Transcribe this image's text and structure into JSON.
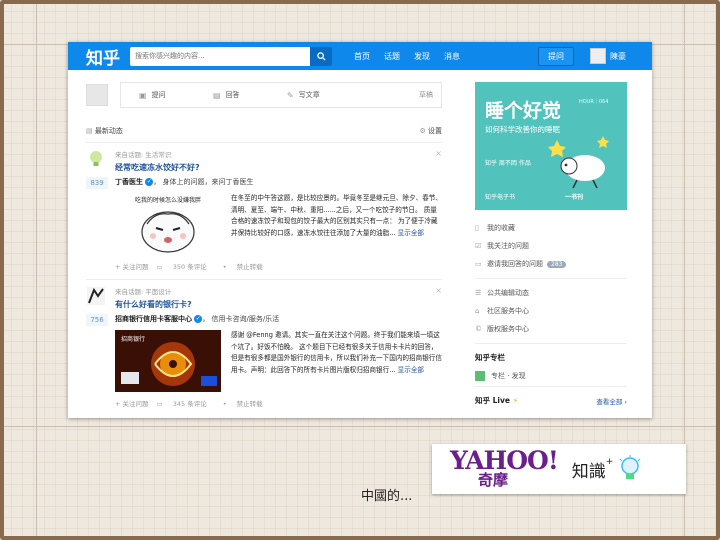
{
  "app": {
    "logo": "知乎"
  },
  "topbar": {
    "search_placeholder": "搜索你感兴趣的内容...",
    "nav": [
      "首页",
      "话题",
      "发现",
      "消息"
    ],
    "ask_label": "提问",
    "username": "陳豪"
  },
  "compose": {
    "items": [
      {
        "icon": "question-icon",
        "label": "提问"
      },
      {
        "icon": "answer-icon",
        "label": "回答"
      },
      {
        "icon": "write-icon",
        "label": "写文章"
      }
    ],
    "draft": "草稿"
  },
  "feed": {
    "title": "最新动态",
    "settings": "设置",
    "items": [
      {
        "source": "来自话题: 生活常识",
        "question": "经常吃速冻水饺好不好?",
        "votes": "839",
        "author": "丁香医生",
        "author_desc": "身体上的问题，来问丁香医生",
        "image_caption": "吃我的时候怎么没嫌我胖",
        "text": "在冬至的中午答这题，是比较应景的。毕竟冬至是继元旦、除夕、春节、清明、夏至、端午、中秋、重阳......之后，又一个吃饺子的节日。 质量合格的速冻饺子和现包的饺子最大的区别其实只有一点： 为了便于冷藏并保持比较好的口感，速冻水饺往往添加了大量的油脂...",
        "show_all": "显示全部",
        "actions": [
          "+ 关注问题",
          "350 条评论",
          "禁止转载"
        ]
      },
      {
        "source": "来自话题: 平面设计",
        "question": "有什么好看的银行卡?",
        "votes": "756",
        "author": "招商银行信用卡客服中心",
        "author_desc": "信用卡咨询/服务/乐活",
        "image_caption": "招商银行",
        "text": "感谢 @Fenng 邀请。其实一直在关注这个问题。终于我们能来填一填这个坑了。好饭不怕晚。 这个题目下已经有很多关于信用卡卡片的回答，但是有很多都是国外银行的信用卡，所以我们补充一下国内的招商银行信用卡。声明：此回答下的所有卡片图片版权归招商银行...",
        "show_all": "显示全部",
        "actions": [
          "+ 关注问题",
          "345 条评论",
          "禁止转载"
        ]
      }
    ]
  },
  "sidebar": {
    "banner": {
      "title": "睡个好觉",
      "subtitle": "如何科学改善你的睡眠",
      "corner": "HOUR｜064",
      "author": "知乎 周不岡 作品",
      "footer": "知乎电子书",
      "footer_right": "一书刊"
    },
    "links_1": [
      {
        "icon": "bookmark-icon",
        "label": "我的收藏"
      },
      {
        "icon": "check-icon",
        "label": "我关注的问题"
      },
      {
        "icon": "invite-icon",
        "label": "邀请我回答的问题",
        "badge": "283"
      }
    ],
    "links_2": [
      {
        "icon": "list-icon",
        "label": "公共编辑动态"
      },
      {
        "icon": "community-icon",
        "label": "社区服务中心"
      },
      {
        "icon": "copyright-icon",
        "label": "版权服务中心"
      }
    ],
    "columns": {
      "title": "知乎专栏",
      "item": "专栏 · 发现"
    },
    "live": {
      "title": "知乎 Live",
      "more": "查看全部 ›"
    }
  },
  "slide": {
    "caption": "中國的...",
    "yahoo_word": "YAHOO!",
    "yahoo_cn": "奇摩",
    "zhishi": "知識",
    "plus": "+"
  },
  "colors": {
    "brand": "#0f88eb",
    "banner": "#52c3bc",
    "frame": "#8a6a4c"
  }
}
